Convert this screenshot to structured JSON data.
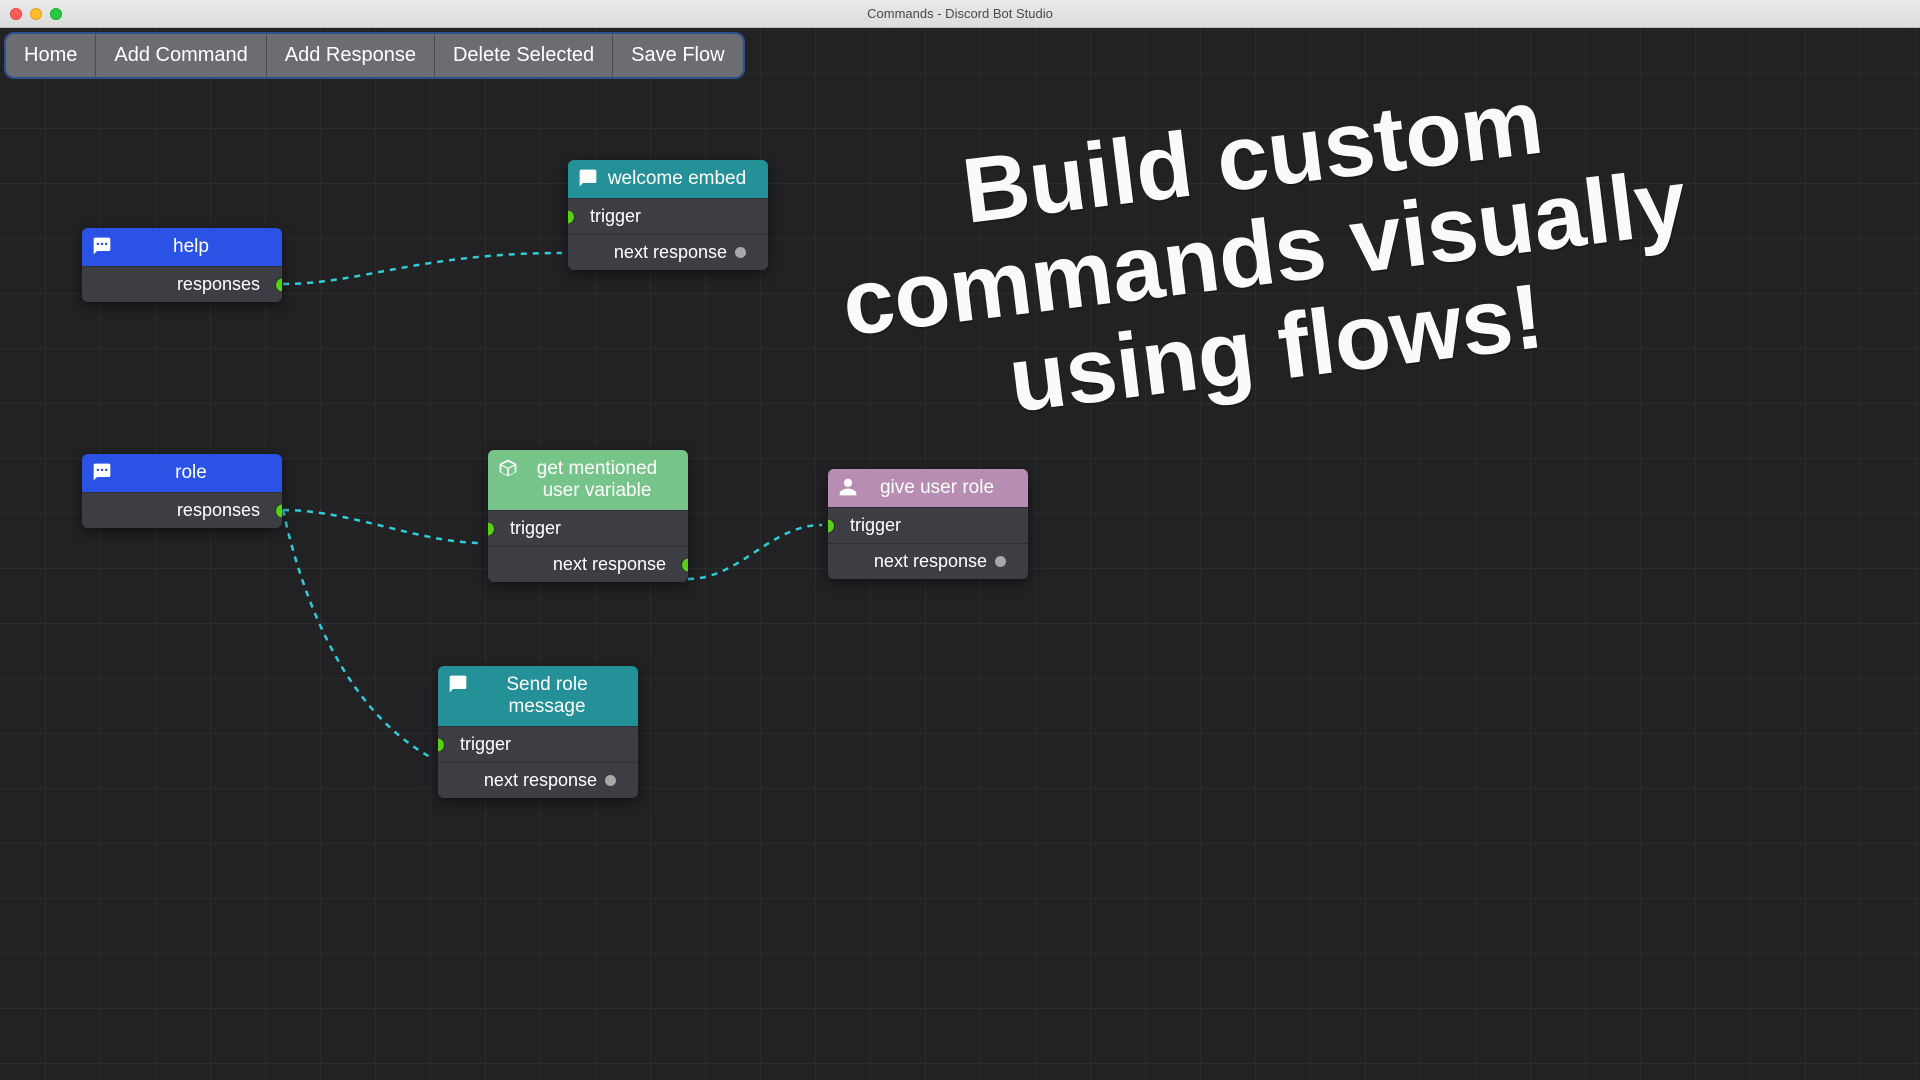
{
  "window": {
    "title": "Commands - Discord Bot Studio"
  },
  "toolbar": {
    "home": "Home",
    "add_command": "Add Command",
    "add_response": "Add Response",
    "delete_selected": "Delete Selected",
    "save_flow": "Save Flow"
  },
  "port_labels": {
    "responses": "responses",
    "trigger": "trigger",
    "next_response": "next response"
  },
  "nodes": {
    "help": {
      "title": "help"
    },
    "welcome": {
      "title": "welcome embed"
    },
    "role": {
      "title": "role"
    },
    "getvar": {
      "title": "get mentioned user variable"
    },
    "giverole": {
      "title": "give user role"
    },
    "sendrole": {
      "title": "Send role message"
    }
  },
  "promo": "Build custom\ncommands visually\nusing flows!",
  "colors": {
    "blue": "#2a53e6",
    "teal": "#239197",
    "green": "#76c48a",
    "purple": "#b88db3",
    "wire": "#2dced6",
    "port_green": "#58d016"
  }
}
